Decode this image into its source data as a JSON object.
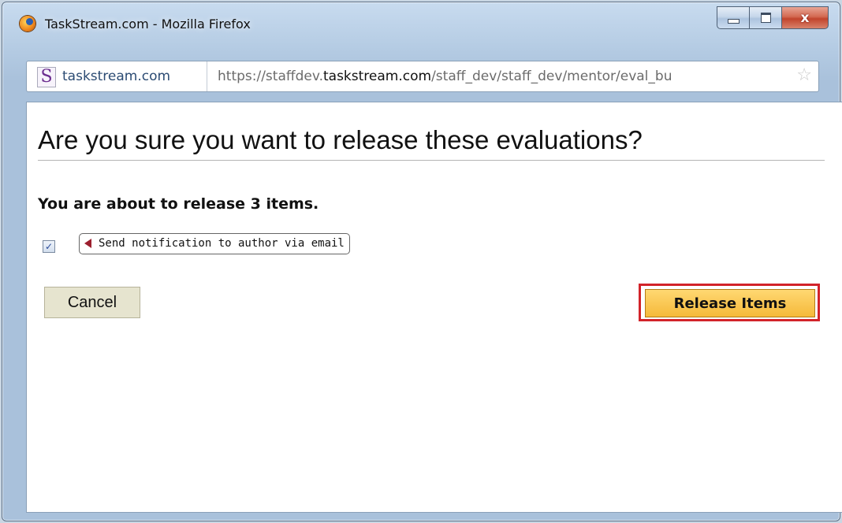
{
  "window": {
    "title": "TaskStream.com - Mozilla Firefox",
    "controls": {
      "minimize": "",
      "maximize": "",
      "close": "x"
    }
  },
  "urlbar": {
    "site_name": "taskstream.com",
    "url_prefix": "https://staffdev.",
    "url_domain": "taskstream.com",
    "url_path": "/staff_dev/staff_dev/mentor/eval_bu",
    "site_logo": "S"
  },
  "dialog": {
    "heading": "Are you sure you want to release these evaluations?",
    "message": "You are about to release 3 items.",
    "notify_checked": true,
    "notify_check_glyph": "✓",
    "notify_label": "Send notification to author via email",
    "cancel_label": "Cancel",
    "release_label": "Release Items"
  },
  "icons": {
    "browser": "firefox-icon",
    "favicon": "taskstream-icon",
    "bookmark": "star-icon"
  }
}
